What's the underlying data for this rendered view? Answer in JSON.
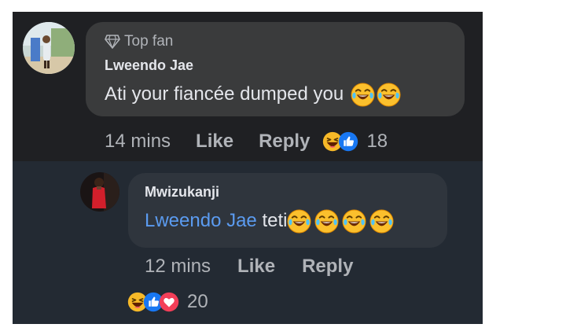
{
  "comment": {
    "badge": "Top fan",
    "author": "Lweendo Jae",
    "text": "Ati your fiancée dumped you",
    "time": "14 mins",
    "like_label": "Like",
    "reply_label": "Reply",
    "reaction_count": "18",
    "reactions": [
      "haha",
      "like"
    ]
  },
  "reply": {
    "author": "Mwizukanji",
    "mention": "Lweendo Jae",
    "text": " teti",
    "time": "12 mins",
    "like_label": "Like",
    "reply_label": "Reply",
    "reaction_count": "20",
    "reactions": [
      "haha",
      "like",
      "love"
    ]
  },
  "colors": {
    "background": "#1f2023",
    "reply_background": "#232a33",
    "bubble": "#3a3b3c",
    "mention": "#5b9bf0",
    "muted_text": "#b0b3b8",
    "like_blue": "#1877f2",
    "love_red": "#f33e58",
    "haha_yellow": "#f7b928"
  }
}
